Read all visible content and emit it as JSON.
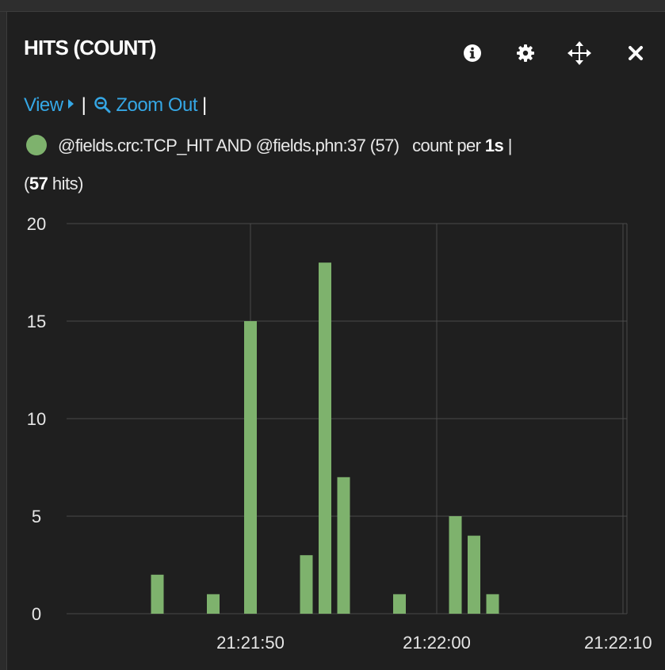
{
  "panel": {
    "title": "HITS (COUNT)",
    "icons": [
      "info-icon",
      "gear-icon",
      "move-icon",
      "close-icon"
    ]
  },
  "links": {
    "view": "View",
    "zoom_out": "Zoom Out",
    "separator": "|"
  },
  "legend": {
    "color": "#7eb26d",
    "query": "@fields.crc:TCP_HIT AND @fields.phn:37 (57)",
    "count_per_prefix": "count per",
    "interval": "1s",
    "separator": "|",
    "hits_open": "(",
    "hits_count": "57",
    "hits_suffix": " hits)"
  },
  "chart_data": {
    "type": "bar",
    "series": [
      {
        "color": "#7eb26d",
        "points": [
          {
            "x": "21:21:45",
            "y": 2
          },
          {
            "x": "21:21:48",
            "y": 1
          },
          {
            "x": "21:21:50",
            "y": 15
          },
          {
            "x": "21:21:53",
            "y": 3
          },
          {
            "x": "21:21:54",
            "y": 18
          },
          {
            "x": "21:21:55",
            "y": 7
          },
          {
            "x": "21:21:58",
            "y": 1
          },
          {
            "x": "21:22:01",
            "y": 5
          },
          {
            "x": "21:22:02",
            "y": 4
          },
          {
            "x": "21:22:03",
            "y": 1
          }
        ]
      }
    ],
    "x_ticks": [
      "21:21:50",
      "21:22:00",
      "21:22:10"
    ],
    "y_ticks": [
      0,
      5,
      10,
      15,
      20
    ],
    "ylim": [
      0,
      20
    ],
    "grid": true
  }
}
